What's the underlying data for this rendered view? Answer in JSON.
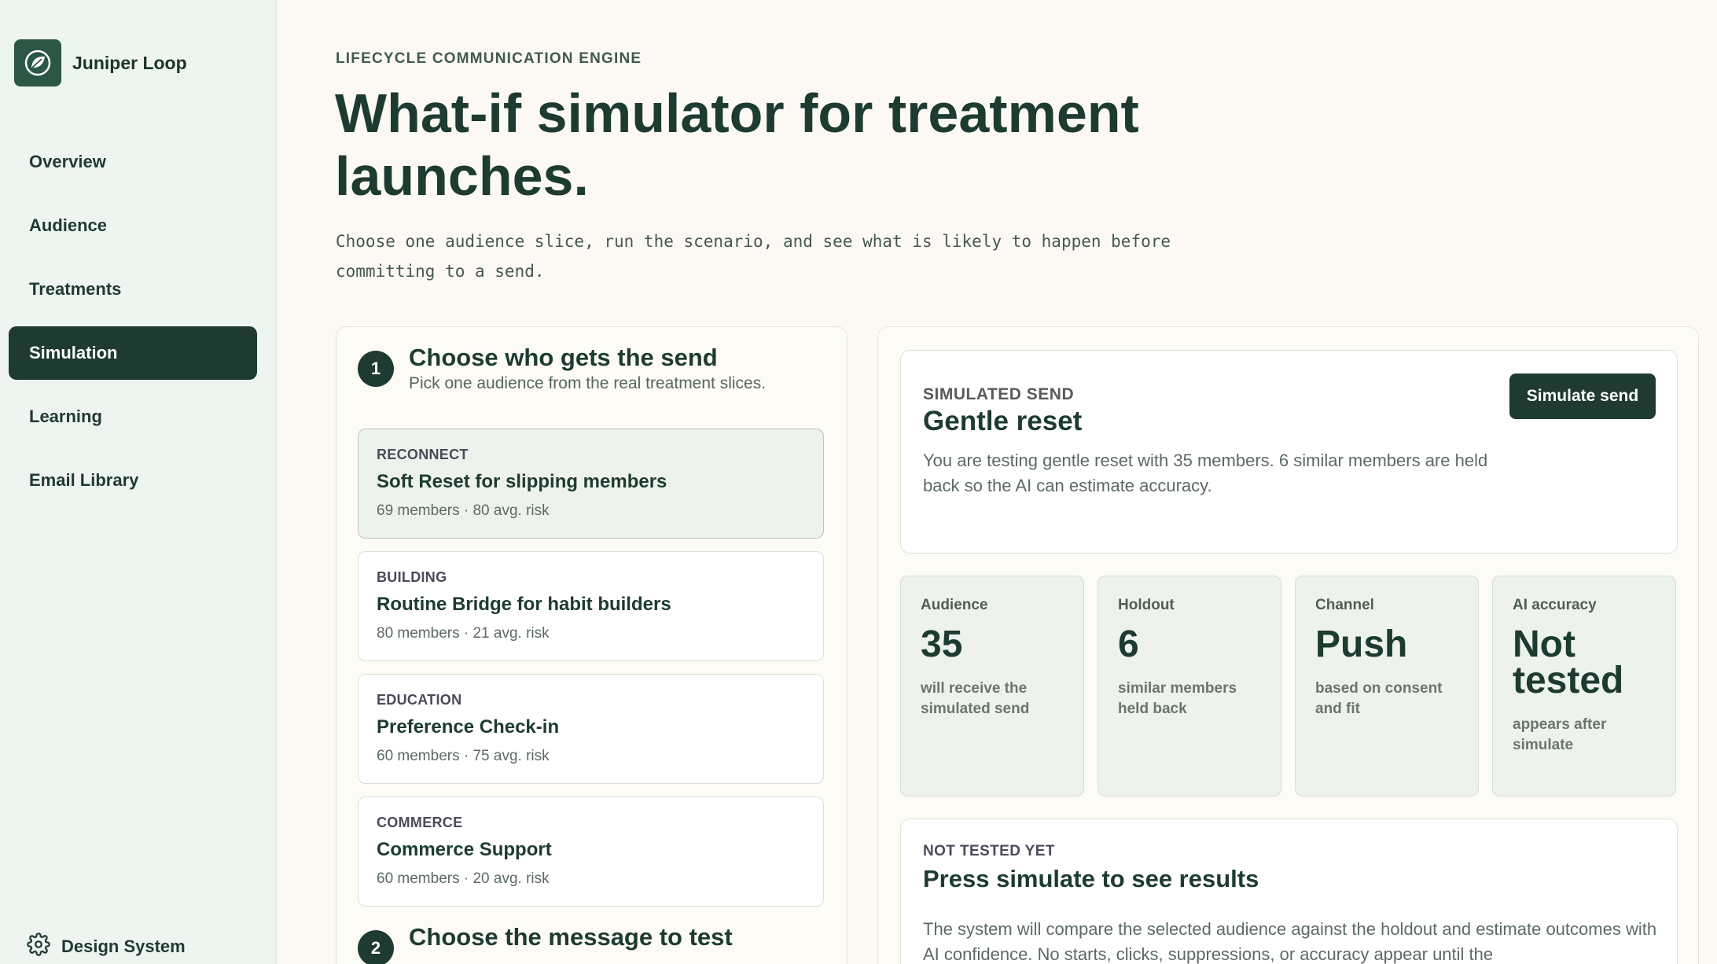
{
  "app": {
    "name": "Juniper Loop",
    "logo_icon": "leaf-icon"
  },
  "sidebar": {
    "items": [
      {
        "label": "Overview",
        "active": false
      },
      {
        "label": "Audience",
        "active": false
      },
      {
        "label": "Treatments",
        "active": false
      },
      {
        "label": "Simulation",
        "active": true
      },
      {
        "label": "Learning",
        "active": false
      },
      {
        "label": "Email Library",
        "active": false
      }
    ],
    "footer": {
      "label": "Design System",
      "icon": "gear-icon"
    }
  },
  "header": {
    "eyebrow": "LIFECYCLE COMMUNICATION ENGINE",
    "title": "What-if simulator for treatment launches.",
    "subtitle": "Choose one audience slice, run the scenario, and see what is likely to happen before committing to a send."
  },
  "step1": {
    "number": "1",
    "title": "Choose who gets the send",
    "subtitle": "Pick one audience from the real treatment slices.",
    "audiences": [
      {
        "tag": "RECONNECT",
        "title": "Soft Reset for slipping members",
        "meta": "69 members · 80 avg. risk",
        "selected": true
      },
      {
        "tag": "BUILDING",
        "title": "Routine Bridge for habit builders",
        "meta": "80 members · 21 avg. risk",
        "selected": false
      },
      {
        "tag": "EDUCATION",
        "title": "Preference Check-in",
        "meta": "60 members · 75 avg. risk",
        "selected": false
      },
      {
        "tag": "COMMERCE",
        "title": "Commerce Support",
        "meta": "60 members · 20 avg. risk",
        "selected": false
      }
    ]
  },
  "step2": {
    "number": "2",
    "title": "Choose the message to test"
  },
  "simulated": {
    "eyebrow": "SIMULATED SEND",
    "title": "Gentle reset",
    "description": "You are testing gentle reset with 35 members. 6 similar members are held back so the AI can estimate accuracy.",
    "button": "Simulate send"
  },
  "metrics": [
    {
      "label": "Audience",
      "value": "35",
      "note": "will receive the simulated send"
    },
    {
      "label": "Holdout",
      "value": "6",
      "note": "similar members held back"
    },
    {
      "label": "Channel",
      "value": "Push",
      "note": "based on consent and fit"
    },
    {
      "label": "AI accuracy",
      "value": "Not tested",
      "note": "appears after simulate"
    }
  ],
  "result": {
    "eyebrow": "NOT TESTED YET",
    "title": "Press simulate to see results",
    "description": "The system will compare the selected audience against the holdout and estimate outcomes with AI confidence. No starts, clicks, suppressions, or accuracy appear until the"
  },
  "colors": {
    "accent": "#1e3a31",
    "sidebar_bg": "#eef4ef",
    "page_bg": "#fcf9f4"
  }
}
